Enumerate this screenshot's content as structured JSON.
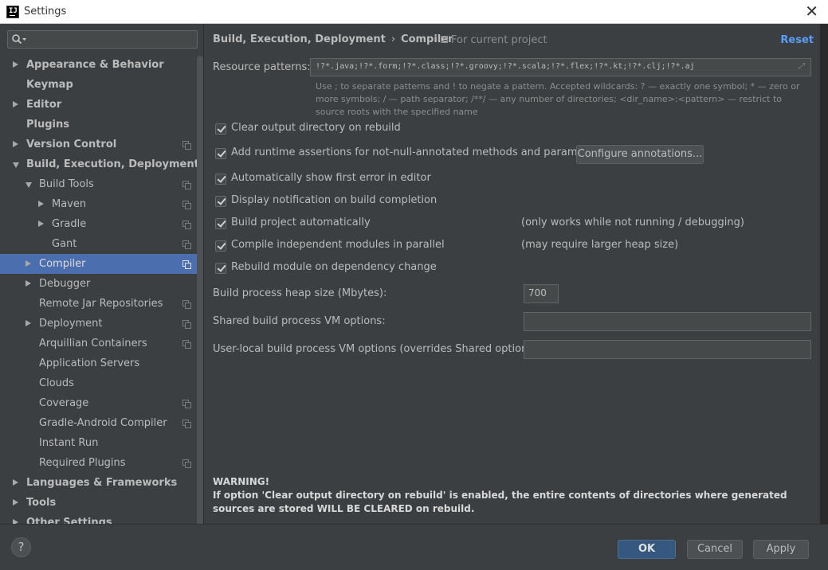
{
  "window": {
    "title": "Settings",
    "app_icon_text": "IJ",
    "close_glyph": "✕"
  },
  "sidebar": {
    "search_placeholder": "",
    "items": [
      {
        "label": "Appearance & Behavior",
        "level": 0,
        "arrow": "right",
        "bold": true,
        "copy": false,
        "selected": false
      },
      {
        "label": "Keymap",
        "level": 0,
        "arrow": "none",
        "bold": true,
        "copy": false,
        "selected": false
      },
      {
        "label": "Editor",
        "level": 0,
        "arrow": "right",
        "bold": true,
        "copy": false,
        "selected": false
      },
      {
        "label": "Plugins",
        "level": 0,
        "arrow": "none",
        "bold": true,
        "copy": false,
        "selected": false
      },
      {
        "label": "Version Control",
        "level": 0,
        "arrow": "right",
        "bold": true,
        "copy": true,
        "selected": false
      },
      {
        "label": "Build, Execution, Deployment",
        "level": 0,
        "arrow": "down",
        "bold": true,
        "copy": false,
        "selected": false
      },
      {
        "label": "Build Tools",
        "level": 1,
        "arrow": "down",
        "bold": false,
        "copy": true,
        "selected": false
      },
      {
        "label": "Maven",
        "level": 2,
        "arrow": "right",
        "bold": false,
        "copy": true,
        "selected": false
      },
      {
        "label": "Gradle",
        "level": 2,
        "arrow": "right",
        "bold": false,
        "copy": true,
        "selected": false
      },
      {
        "label": "Gant",
        "level": 2,
        "arrow": "none",
        "bold": false,
        "copy": true,
        "selected": false
      },
      {
        "label": "Compiler",
        "level": 1,
        "arrow": "right",
        "bold": false,
        "copy": true,
        "selected": true
      },
      {
        "label": "Debugger",
        "level": 1,
        "arrow": "right",
        "bold": false,
        "copy": false,
        "selected": false
      },
      {
        "label": "Remote Jar Repositories",
        "level": 1,
        "arrow": "none",
        "bold": false,
        "copy": true,
        "selected": false
      },
      {
        "label": "Deployment",
        "level": 1,
        "arrow": "right",
        "bold": false,
        "copy": true,
        "selected": false
      },
      {
        "label": "Arquillian Containers",
        "level": 1,
        "arrow": "none",
        "bold": false,
        "copy": true,
        "selected": false
      },
      {
        "label": "Application Servers",
        "level": 1,
        "arrow": "none",
        "bold": false,
        "copy": false,
        "selected": false
      },
      {
        "label": "Clouds",
        "level": 1,
        "arrow": "none",
        "bold": false,
        "copy": false,
        "selected": false
      },
      {
        "label": "Coverage",
        "level": 1,
        "arrow": "none",
        "bold": false,
        "copy": true,
        "selected": false
      },
      {
        "label": "Gradle-Android Compiler",
        "level": 1,
        "arrow": "none",
        "bold": false,
        "copy": true,
        "selected": false
      },
      {
        "label": "Instant Run",
        "level": 1,
        "arrow": "none",
        "bold": false,
        "copy": false,
        "selected": false
      },
      {
        "label": "Required Plugins",
        "level": 1,
        "arrow": "none",
        "bold": false,
        "copy": true,
        "selected": false
      },
      {
        "label": "Languages & Frameworks",
        "level": 0,
        "arrow": "right",
        "bold": true,
        "copy": false,
        "selected": false
      },
      {
        "label": "Tools",
        "level": 0,
        "arrow": "right",
        "bold": true,
        "copy": false,
        "selected": false
      },
      {
        "label": "Other Settings",
        "level": 0,
        "arrow": "right",
        "bold": true,
        "copy": false,
        "selected": false
      }
    ]
  },
  "header": {
    "breadcrumb_parent": "Build, Execution, Deployment",
    "breadcrumb_sep": "›",
    "breadcrumb_current": "Compiler",
    "scope": "For current project",
    "reset": "Reset"
  },
  "resource_patterns": {
    "label": "Resource patterns:",
    "value": "!?*.java;!?*.form;!?*.class;!?*.groovy;!?*.scala;!?*.flex;!?*.kt;!?*.clj;!?*.aj",
    "hint": "Use ; to separate patterns and ! to negate a pattern. Accepted wildcards: ? — exactly one symbol; * — zero or more symbols; / — path separator; /**/ — any number of directories; <dir_name>:<pattern> — restrict to source roots with the specified name"
  },
  "options": {
    "clear_output": "Clear output directory on rebuild",
    "runtime_assertions": "Add runtime assertions for not-null-annotated methods and parameters",
    "configure_annotations": "Configure annotations...",
    "show_first_error": "Automatically show first error in editor",
    "display_notification": "Display notification on build completion",
    "build_automatically": "Build project automatically",
    "build_automatically_note": "(only works while not running / debugging)",
    "compile_parallel": "Compile independent modules in parallel",
    "compile_parallel_note": "(may require larger heap size)",
    "rebuild_on_change": "Rebuild module on dependency change"
  },
  "heap": {
    "label": "Build process heap size (Mbytes):",
    "value": "700"
  },
  "vm_options": {
    "shared_label": "Shared build process VM options:",
    "shared_value": "",
    "local_label": "User-local build process VM options (overrides Shared options):",
    "local_value": ""
  },
  "warning": {
    "title": "WARNING!",
    "text": "If option 'Clear output directory on rebuild' is enabled, the entire contents of directories where generated sources are stored WILL BE CLEARED on rebuild."
  },
  "footer": {
    "help": "?",
    "ok": "OK",
    "cancel": "Cancel",
    "apply": "Apply"
  }
}
